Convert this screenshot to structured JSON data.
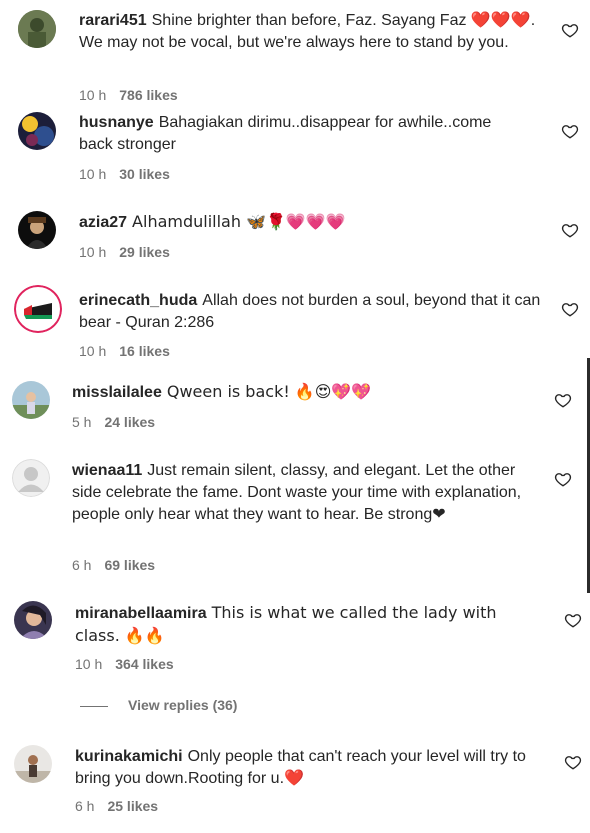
{
  "comments": [
    {
      "username": "rarari451",
      "text": "Shine brighter than before, Faz. Sayang Faz ❤️❤️❤️. We may not be vocal, but we're always here to stand by you.",
      "time": "10 h",
      "likes": "786 likes"
    },
    {
      "username": "husnanye",
      "text": "Bahagiakan dirimu..disappear for awhile..come back stronger",
      "time": "10 h",
      "likes": "30 likes"
    },
    {
      "username": "azia27",
      "text": "Alhamdulillah 🦋🌹💗💗💗",
      "time": "10 h",
      "likes": "29 likes"
    },
    {
      "username": "erinecath_huda",
      "text": "Allah does not burden a soul, beyond that it can bear - Quran 2:286",
      "time": "10 h",
      "likes": "16 likes"
    },
    {
      "username": "misslailalee",
      "text": "Qween is back! 🔥😍💖💖",
      "time": "5 h",
      "likes": "24 likes"
    },
    {
      "username": "wienaa11",
      "text": "Just remain silent, classy, and elegant. Let the other side celebrate the fame. Dont waste your time with explanation, people only hear what they want to hear. Be strong❤",
      "time": "6 h",
      "likes": "69 likes"
    },
    {
      "username": "miranabellaamira",
      "text": "This is what we called the lady with class. 🔥🔥",
      "time": "10 h",
      "likes": "364 likes"
    },
    {
      "username": "kurinakamichi",
      "text": "Only people that can't reach your level will try to bring you down.Rooting for u.❤️",
      "time": "6 h",
      "likes": "25 likes"
    }
  ],
  "view_replies": "View replies (36)",
  "colors": {
    "text": "#262626",
    "meta": "#737373",
    "heart": "#e0245e"
  }
}
